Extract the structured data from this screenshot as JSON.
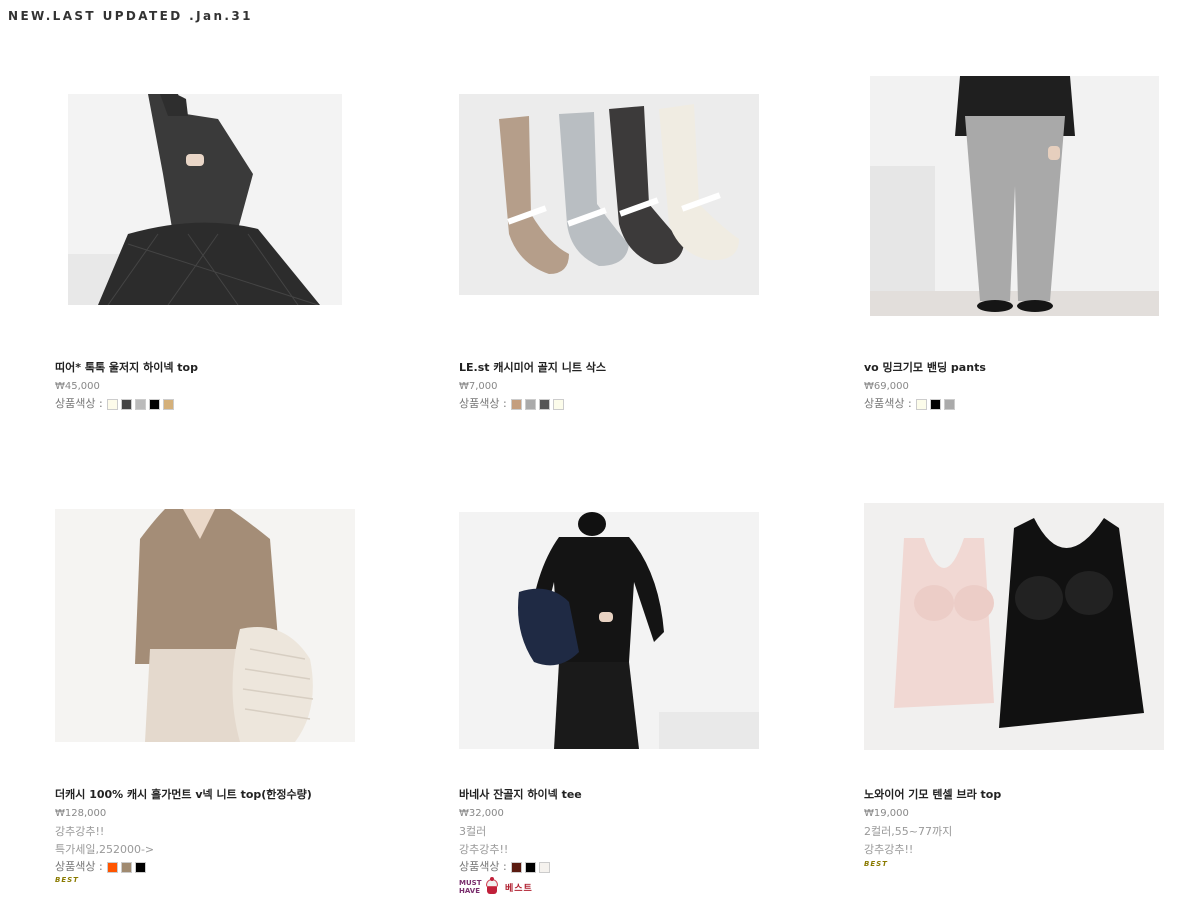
{
  "header": {
    "title": "NEW.LAST UPDATED .Jan.31"
  },
  "color_label": "상품색상 :",
  "products": [
    {
      "name": "띠어* 톡톡 울저지 하이넥 top",
      "price": "₩45,000",
      "notes": [],
      "colors": [
        "#fdfbea",
        "#444444",
        "#bbbbbb",
        "#000000",
        "#d4b07a"
      ],
      "badge_best": "",
      "image": "model-gray-turtleneck-quilted-skirt"
    },
    {
      "name": "LE.st 캐시미어 골지 니트 삭스",
      "price": "₩7,000",
      "notes": [],
      "colors": [
        "#c49e7e",
        "#aaaaaa",
        "#555555",
        "#fcfcea"
      ],
      "badge_best": "",
      "image": "four-knit-socks"
    },
    {
      "name": "vo 밍크기모 밴딩 pants",
      "price": "₩69,000",
      "notes": [],
      "colors": [
        "#fcfcea",
        "#000000",
        "#aaaaaa"
      ],
      "badge_best": "",
      "image": "model-gray-pants-padded-jacket"
    },
    {
      "name": "더캐시 100% 캐시 홀가먼트 v넥 니트 top(한정수량)",
      "price": "₩128,000",
      "notes": [
        "강추강추!!",
        "특가세일,252000->"
      ],
      "colors": [
        "#ff5500",
        "#a08a70",
        "#000000"
      ],
      "badge_best": "BEST",
      "image": "model-beige-vneck-knit"
    },
    {
      "name": "바네사 잔골지 하이넥 tee",
      "price": "₩32,000",
      "notes": [
        "3컬러",
        "강추강추!!"
      ],
      "colors": [
        "#5a1a10",
        "#000000",
        "#f5f2ee"
      ],
      "badge_best": "",
      "icons": {
        "must": "MUST HAVE",
        "best_kr": "베스트"
      },
      "image": "model-black-highneck-tee"
    },
    {
      "name": "노와이어 기모 텐셀 브라 top",
      "price": "₩19,000",
      "notes": [
        "2컬러,55~77까지",
        "강추강추!!"
      ],
      "colors": [],
      "badge_best": "BEST",
      "image": "pink-black-bra-tops"
    }
  ]
}
